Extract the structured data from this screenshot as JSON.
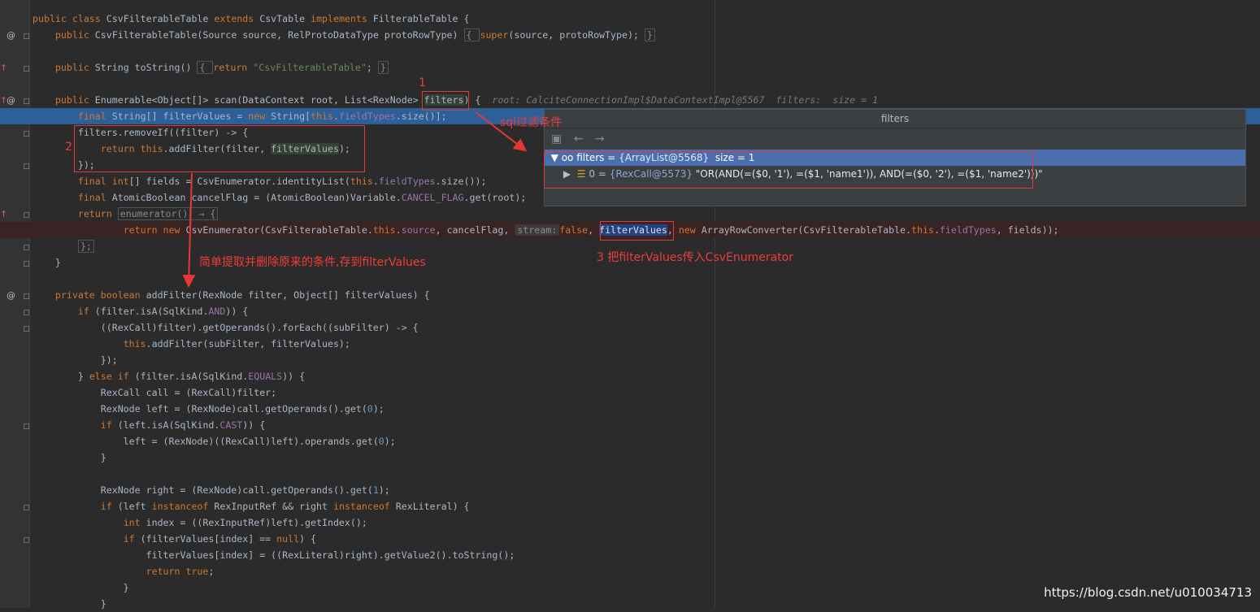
{
  "editor": {
    "lines": [
      {
        "parts": [
          [
            "kw",
            "public class "
          ],
          [
            "",
            "CsvFilterableTable "
          ],
          [
            "kw",
            "extends "
          ],
          [
            "",
            "CsvTable "
          ],
          [
            "kw",
            "implements "
          ],
          [
            "",
            "FilterableTable {"
          ]
        ]
      },
      {
        "parts": [
          [
            "",
            "    "
          ],
          [
            "kw",
            "public "
          ],
          [
            "",
            "CsvFilterableTable(Source source, RelProtoDataType protoRowType) "
          ],
          [
            "fold",
            "{ "
          ],
          [
            "kw",
            "super"
          ],
          [
            "",
            "(source, protoRowType); "
          ],
          [
            "fold",
            "}"
          ]
        ]
      },
      {
        "parts": []
      },
      {
        "parts": [
          [
            "",
            "    "
          ],
          [
            "kw",
            "public "
          ],
          [
            "",
            "String toString() "
          ],
          [
            "fold",
            "{ "
          ],
          [
            "kw",
            "return "
          ],
          [
            "str",
            "\"CsvFilterableTable\""
          ],
          [
            "",
            "; "
          ],
          [
            "fold",
            "}"
          ]
        ]
      },
      {
        "parts": []
      },
      {
        "parts": [
          [
            "",
            "    "
          ],
          [
            "kw",
            "public "
          ],
          [
            "",
            "Enumerable<Object[]> scan(DataContext root, List<RexNode> "
          ],
          [
            "hl",
            "filters"
          ],
          [
            "",
            ") {  "
          ],
          [
            "hint",
            "root: CalciteConnectionImpl$DataContextImpl@5567  filters:  size = 1"
          ]
        ]
      },
      {
        "parts": [
          [
            "",
            "        "
          ],
          [
            "kw",
            "final "
          ],
          [
            "",
            "String[] filterValues = "
          ],
          [
            "kw",
            "new "
          ],
          [
            "",
            "String["
          ],
          [
            "kw",
            "this"
          ],
          [
            "",
            "."
          ],
          [
            "fld",
            "fieldTypes"
          ],
          [
            "",
            ".size()];"
          ]
        ]
      },
      {
        "parts": [
          [
            "",
            "        filters.removeIf((filter) -> {"
          ]
        ]
      },
      {
        "parts": [
          [
            "",
            "            "
          ],
          [
            "kw",
            "return this"
          ],
          [
            "",
            ".addFilter(filter, "
          ],
          [
            "hl",
            "filterValues"
          ],
          [
            "",
            ");"
          ]
        ]
      },
      {
        "parts": [
          [
            "",
            "        });"
          ]
        ]
      },
      {
        "parts": [
          [
            "",
            "        "
          ],
          [
            "kw",
            "final int"
          ],
          [
            "",
            "[] fields = CsvEnumerator.identityList("
          ],
          [
            "kw",
            "this"
          ],
          [
            "",
            "."
          ],
          [
            "fld",
            "fieldTypes"
          ],
          [
            "",
            ".size());"
          ]
        ]
      },
      {
        "parts": [
          [
            "",
            "        "
          ],
          [
            "kw",
            "final "
          ],
          [
            "",
            "AtomicBoolean cancelFlag = (AtomicBoolean)Variable."
          ],
          [
            "fld",
            "CANCEL_FLAG"
          ],
          [
            "",
            ".get(root);"
          ]
        ]
      },
      {
        "parts": [
          [
            "",
            "        "
          ],
          [
            "kw",
            "return "
          ],
          [
            "fold",
            "enumerator()"
          ],
          [
            "fold",
            " → {"
          ]
        ]
      },
      {
        "parts": [
          [
            "",
            "                "
          ],
          [
            "kw",
            "return new "
          ],
          [
            "",
            "CsvEnumerator(CsvFilterableTable."
          ],
          [
            "kw",
            "this"
          ],
          [
            "",
            "."
          ],
          [
            "fld",
            "source"
          ],
          [
            "",
            ", cancelFlag, "
          ],
          [
            "param",
            "stream:"
          ],
          [
            "kw",
            "false"
          ],
          [
            "",
            ", "
          ],
          [
            "selword",
            "filterValues"
          ],
          [
            "",
            ", "
          ],
          [
            "kw",
            "new "
          ],
          [
            "",
            "ArrayRowConverter(CsvFilterableTable."
          ],
          [
            "kw",
            "this"
          ],
          [
            "",
            "."
          ],
          [
            "fld",
            "fieldTypes"
          ],
          [
            "",
            ", fields));"
          ]
        ]
      },
      {
        "parts": [
          [
            "",
            "        "
          ],
          [
            "fold",
            "};"
          ]
        ]
      },
      {
        "parts": [
          [
            "",
            "    }"
          ]
        ]
      },
      {
        "parts": []
      },
      {
        "parts": [
          [
            "",
            "    "
          ],
          [
            "kw",
            "private boolean "
          ],
          [
            "",
            "addFilter(RexNode filter, Object[] filterValues) {"
          ]
        ]
      },
      {
        "parts": [
          [
            "",
            "        "
          ],
          [
            "kw",
            "if "
          ],
          [
            "",
            "(filter.isA(SqlKind."
          ],
          [
            "fld",
            "AND"
          ],
          [
            "",
            "))"
          ],
          [
            "",
            ""
          ],
          [
            "",
            " {"
          ]
        ]
      },
      {
        "parts": [
          [
            "",
            "            ((RexCall)filter).getOperands().forEach((subFilter) -> {"
          ]
        ]
      },
      {
        "parts": [
          [
            "",
            "                "
          ],
          [
            "kw",
            "this"
          ],
          [
            "",
            ".addFilter(subFilter, filterValues);"
          ]
        ]
      },
      {
        "parts": [
          [
            "",
            "            });"
          ]
        ]
      },
      {
        "parts": [
          [
            "",
            "        } "
          ],
          [
            "kw",
            "else if "
          ],
          [
            "",
            "(filter.isA(SqlKind."
          ],
          [
            "fld",
            "EQUALS"
          ],
          [
            "",
            ")) {"
          ]
        ]
      },
      {
        "parts": [
          [
            "",
            "            RexCall call = (RexCall)filter;"
          ]
        ]
      },
      {
        "parts": [
          [
            "",
            "            RexNode left = (RexNode)call.getOperands().get("
          ],
          [
            "num",
            "0"
          ],
          [
            "",
            ");"
          ]
        ]
      },
      {
        "parts": [
          [
            "",
            "            "
          ],
          [
            "kw",
            "if "
          ],
          [
            "",
            "(left.isA(SqlKind."
          ],
          [
            "fld",
            "CAST"
          ],
          [
            "",
            ")) {"
          ]
        ]
      },
      {
        "parts": [
          [
            "",
            "                left = (RexNode)((RexCall)left).operands.get("
          ],
          [
            "num",
            "0"
          ],
          [
            "",
            ");"
          ]
        ]
      },
      {
        "parts": [
          [
            "",
            "            }"
          ]
        ]
      },
      {
        "parts": []
      },
      {
        "parts": [
          [
            "",
            "            RexNode right = (RexNode)call.getOperands().get("
          ],
          [
            "num",
            "1"
          ],
          [
            "",
            ");"
          ]
        ]
      },
      {
        "parts": [
          [
            "",
            "            "
          ],
          [
            "kw",
            "if "
          ],
          [
            "",
            "(left "
          ],
          [
            "kw",
            "instanceof "
          ],
          [
            "",
            "RexInputRef && right "
          ],
          [
            "kw",
            "instanceof "
          ],
          [
            "",
            "RexLiteral) {"
          ]
        ]
      },
      {
        "parts": [
          [
            "",
            "                "
          ],
          [
            "kw",
            "int "
          ],
          [
            "",
            "index = ((RexInputRef)left).getIndex();"
          ]
        ]
      },
      {
        "parts": [
          [
            "",
            "                "
          ],
          [
            "kw",
            "if "
          ],
          [
            "",
            "(filterValues[index] == "
          ],
          [
            "kw",
            "null"
          ],
          [
            "",
            ") {"
          ]
        ]
      },
      {
        "parts": [
          [
            "",
            "                    filterValues[index] = ((RexLiteral)right).getValue2().toString();"
          ]
        ]
      },
      {
        "parts": [
          [
            "",
            "                    "
          ],
          [
            "kw",
            "return true"
          ],
          [
            "",
            ";"
          ]
        ]
      },
      {
        "parts": [
          [
            "",
            "                }"
          ]
        ]
      },
      {
        "parts": [
          [
            "",
            "            }"
          ]
        ]
      }
    ]
  },
  "popup": {
    "title": "filters",
    "toolbar": [
      "▣",
      "←",
      "→"
    ],
    "row1": {
      "expander": "▼",
      "icon": "oo",
      "name": "filters",
      "eq": " = ",
      "ref": "{ArrayList@5568}",
      "extra": "  size = 1"
    },
    "row2": {
      "expander": "▶",
      "icon": "☰",
      "name": "0",
      "eq": " = ",
      "ref": "{RexCall@5573}",
      "value": " \"OR(AND(=($0, '1'), =($1, 'name1')), AND(=($0, '2'), =($1, 'name2')))\""
    }
  },
  "annotations": {
    "label1": "1",
    "label2": "2",
    "sql_label": "sql过滤条件",
    "extract_label": "简单提取并删除原来的条件,存到filterValues",
    "step3_label": "3 把filterValues传入CsvEnumerator"
  },
  "watermark": "https://blog.csdn.net/u010034713"
}
